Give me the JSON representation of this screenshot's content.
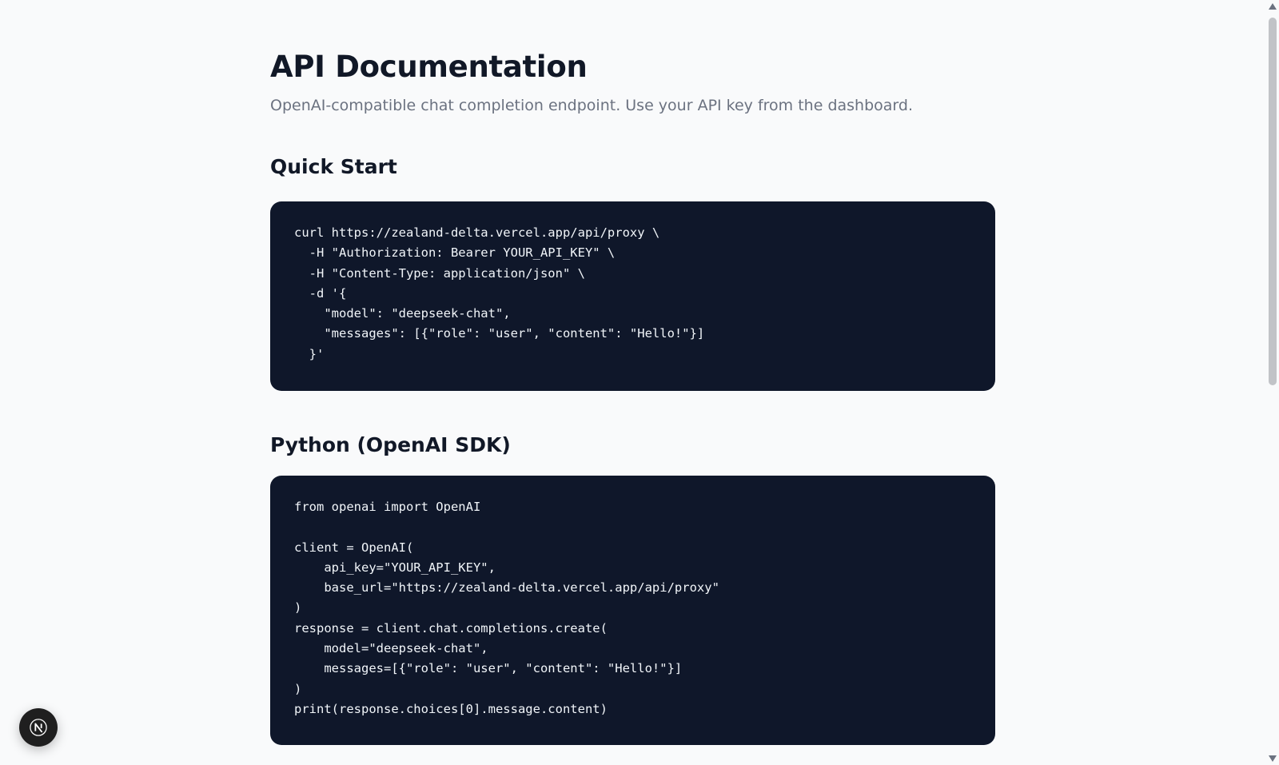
{
  "header": {
    "title": "API Documentation",
    "subtitle": "OpenAI-compatible chat completion endpoint. Use your API key from the dashboard."
  },
  "sections": [
    {
      "heading": "Quick Start",
      "code": "curl https://zealand-delta.vercel.app/api/proxy \\\n  -H \"Authorization: Bearer YOUR_API_KEY\" \\\n  -H \"Content-Type: application/json\" \\\n  -d '{\n    \"model\": \"deepseek-chat\",\n    \"messages\": [{\"role\": \"user\", \"content\": \"Hello!\"}]\n  }'"
    },
    {
      "heading": "Python (OpenAI SDK)",
      "code": "from openai import OpenAI\n\nclient = OpenAI(\n    api_key=\"YOUR_API_KEY\",\n    base_url=\"https://zealand-delta.vercel.app/api/proxy\"\n)\nresponse = client.chat.completions.create(\n    model=\"deepseek-chat\",\n    messages=[{\"role\": \"user\", \"content\": \"Hello!\"}]\n)\nprint(response.choices[0].message.content)"
    }
  ],
  "dev_badge": {
    "icon": "nextjs-logo-icon"
  },
  "colors": {
    "page_background": "#f9fafb",
    "code_background": "#0f172a",
    "code_text": "#f1f5f9",
    "title_text": "#111827",
    "subtitle_text": "#6b7280"
  }
}
